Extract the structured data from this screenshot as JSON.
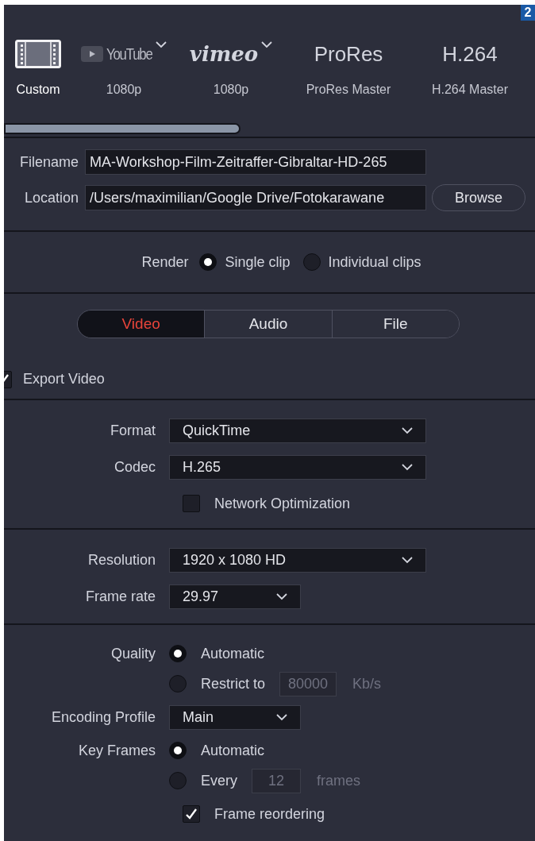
{
  "figure_badge": "2",
  "presets": [
    {
      "kind": "custom",
      "label": "Custom",
      "selected": true
    },
    {
      "kind": "youtube",
      "logo": "YouTube",
      "has_menu": true,
      "label": "1080p",
      "selected": false
    },
    {
      "kind": "vimeo",
      "logo": "vimeo",
      "has_menu": true,
      "label": "1080p",
      "selected": false
    },
    {
      "kind": "text",
      "logo": "ProRes",
      "has_menu": false,
      "label": "ProRes Master",
      "selected": false
    },
    {
      "kind": "text",
      "logo": "H.264",
      "has_menu": false,
      "label": "H.264 Master",
      "selected": false
    }
  ],
  "file": {
    "filename_label": "Filename",
    "filename": "MA-Workshop-Film-Zeitraffer-Gibraltar-HD-265",
    "location_label": "Location",
    "location": "/Users/maximilian/Google Drive/Fotokarawane",
    "browse": "Browse"
  },
  "render": {
    "label": "Render",
    "options": [
      {
        "label": "Single clip",
        "selected": true
      },
      {
        "label": "Individual clips",
        "selected": false
      }
    ]
  },
  "tabs": [
    {
      "label": "Video",
      "selected": true
    },
    {
      "label": "Audio",
      "selected": false
    },
    {
      "label": "File",
      "selected": false
    }
  ],
  "export_video": {
    "label": "Export Video",
    "checked": true
  },
  "sections": [
    [
      {
        "kind": "dropdown",
        "label": "Format",
        "value": "QuickTime"
      },
      {
        "kind": "dropdown",
        "label": "Codec",
        "value": "H.265"
      },
      {
        "kind": "checkbox",
        "label": "Network Optimization",
        "checked": false
      }
    ],
    [
      {
        "kind": "dropdown",
        "label": "Resolution",
        "value": "1920 x 1080 HD"
      },
      {
        "kind": "short_dropdown",
        "label": "Frame rate",
        "value": "29.97"
      }
    ],
    [
      {
        "kind": "radio",
        "label": "Quality",
        "options": [
          {
            "label": "Automatic",
            "selected": true
          },
          {
            "label": "Restrict to",
            "selected": false,
            "field": "80000",
            "unit": "Kb/s"
          }
        ]
      },
      {
        "kind": "short_dropdown",
        "label": "Encoding Profile",
        "value": "Main"
      },
      {
        "kind": "radio",
        "label": "Key Frames",
        "options": [
          {
            "label": "Automatic",
            "selected": true
          },
          {
            "label": "Every",
            "selected": false,
            "field": "12",
            "unit": "frames"
          }
        ]
      },
      {
        "kind": "checkbox",
        "label": "Frame reordering",
        "checked": true
      }
    ]
  ]
}
